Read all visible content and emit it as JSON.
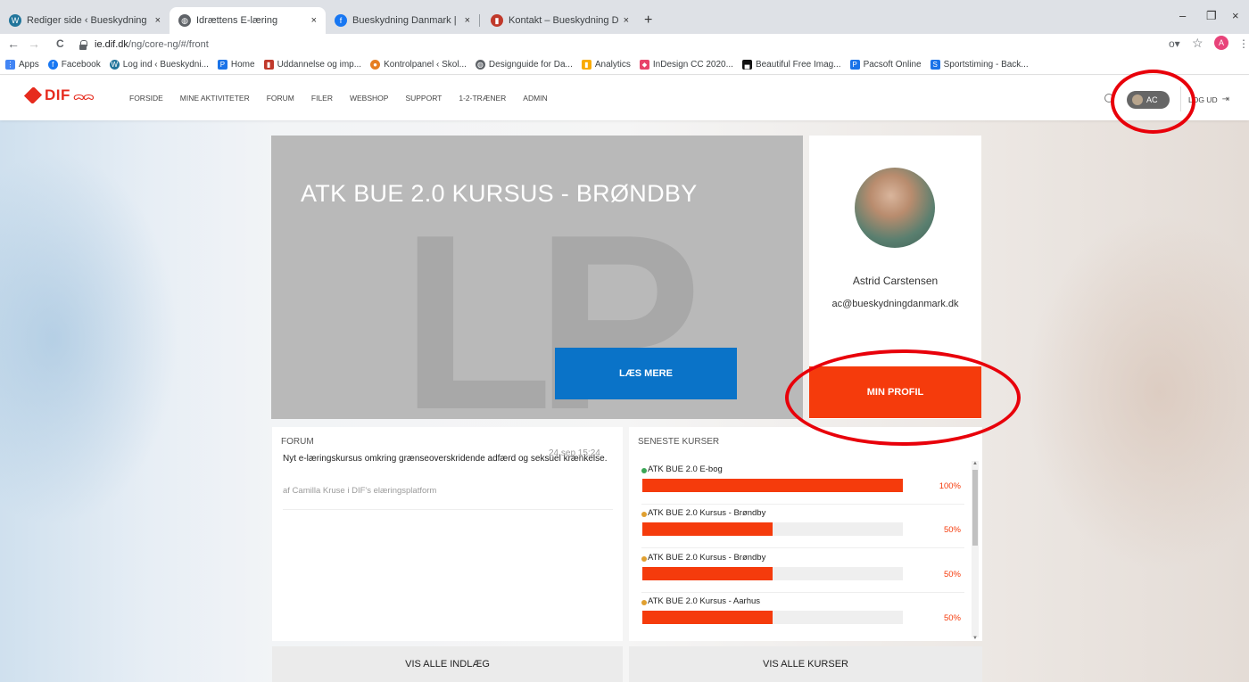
{
  "browser": {
    "tabs": [
      {
        "label": "Rediger side ‹ Bueskydning Danm",
        "icon": "wordpress-icon",
        "color": "#21759b"
      },
      {
        "label": "Idrættens E-læring",
        "icon": "globe-icon",
        "color": "#5f6368"
      },
      {
        "label": "Bueskydning Danmark | Faceboo",
        "icon": "facebook-icon",
        "color": "#1877f2"
      },
      {
        "label": "Kontakt – Bueskydning Danmark",
        "icon": "site-icon",
        "color": "#c0392b"
      }
    ],
    "tab_close": "×",
    "new_tab": "+",
    "window_controls": {
      "minimize": "–",
      "restore": "❐",
      "close": "×"
    },
    "nav": {
      "back": "←",
      "forward": "→",
      "reload": "C"
    },
    "url_host": "ie.dif.dk",
    "url_path": "/ng/core-ng/#/front",
    "toolbar_icons": {
      "key": "o▾",
      "star": "☆",
      "menu": "⋮"
    },
    "profile_initial": "A",
    "bookmarks": [
      {
        "label": "Apps",
        "icon": "apps-grid-icon",
        "color": "#4285f4"
      },
      {
        "label": "Facebook",
        "icon": "facebook-icon",
        "color": "#1877f2"
      },
      {
        "label": "Log ind ‹ Bueskydni...",
        "icon": "wordpress-icon",
        "color": "#21759b"
      },
      {
        "label": "Home",
        "icon": "home-icon",
        "color": "#1a73e8"
      },
      {
        "label": "Uddannelse og imp...",
        "icon": "site-icon",
        "color": "#c0392b"
      },
      {
        "label": "Kontrolpanel ‹ Skol...",
        "icon": "site-icon",
        "color": "#e67e22"
      },
      {
        "label": "Designguide for Da...",
        "icon": "globe-icon",
        "color": "#5f6368"
      },
      {
        "label": "Analytics",
        "icon": "analytics-icon",
        "color": "#f9ab00"
      },
      {
        "label": "InDesign CC 2020...",
        "icon": "indesign-icon",
        "color": "#e8436a"
      },
      {
        "label": "Beautiful Free Imag...",
        "icon": "unsplash-icon",
        "color": "#111111"
      },
      {
        "label": "Pacsoft Online",
        "icon": "pacsoft-icon",
        "color": "#1a73e8"
      },
      {
        "label": "Sportstiming - Back...",
        "icon": "sportstiming-icon",
        "color": "#1a73e8"
      }
    ]
  },
  "header": {
    "logo_text": "DIF",
    "logo_rings": "ᯅᯅ",
    "nav": [
      "FORSIDE",
      "MINE AKTIVITETER",
      "FORUM",
      "FILER",
      "WEBSHOP",
      "SUPPORT",
      "1-2-TRÆNER",
      "ADMIN"
    ],
    "user_initials": "AC",
    "logout": "LOG UD"
  },
  "hero": {
    "title": "ATK BUE 2.0 KURSUS - BRØNDBY",
    "watermark": "LP",
    "button": "LÆS MERE"
  },
  "profile": {
    "name": "Astrid Carstensen",
    "email": "ac@bueskydningdanmark.dk",
    "button": "MIN PROFIL"
  },
  "forum": {
    "title": "FORUM",
    "post_title": "Nyt e-læringskursus omkring grænseoverskridende adfærd og seksuel krænkelse.",
    "post_date": "24 sep 15:24",
    "post_author": "af Camilla Kruse i DIF's elæringsplatform",
    "button": "VIS ALLE INDLÆG"
  },
  "courses": {
    "title": "SENESTE KURSER",
    "items": [
      {
        "name": "ATK BUE 2.0 E-bog",
        "progress": 100,
        "pct_label": "100%",
        "status_color": "#3aa655"
      },
      {
        "name": "ATK BUE 2.0 Kursus - Brøndby",
        "progress": 50,
        "pct_label": "50%",
        "status_color": "#e0a030"
      },
      {
        "name": "ATK BUE 2.0 Kursus - Brøndby",
        "progress": 50,
        "pct_label": "50%",
        "status_color": "#e0a030"
      },
      {
        "name": "ATK BUE 2.0 Kursus - Aarhus",
        "progress": 50,
        "pct_label": "50%",
        "status_color": "#e0a030"
      }
    ],
    "button": "VIS ALLE KURSER"
  },
  "colors": {
    "accent_red": "#f53b0c",
    "blue_button": "#0a73c8",
    "annotation_red": "#e8000a"
  }
}
